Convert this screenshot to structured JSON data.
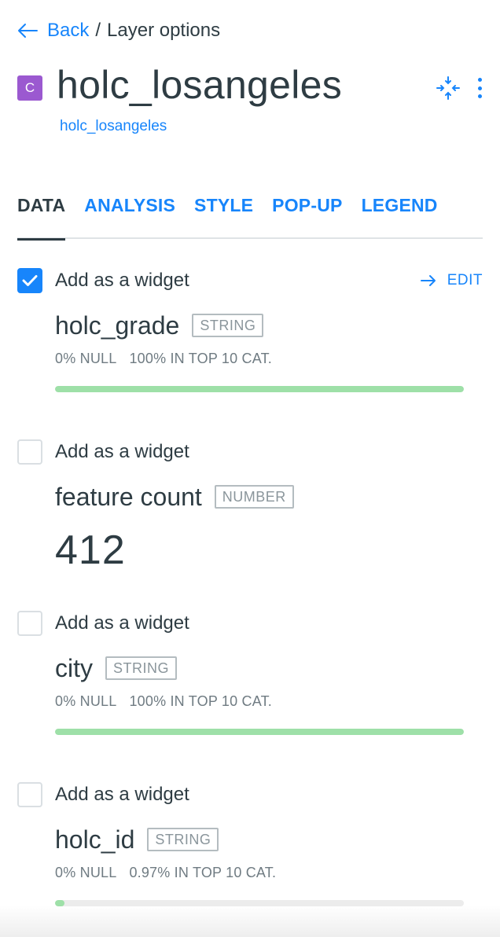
{
  "breadcrumb": {
    "back_label": "Back",
    "separator": "/",
    "current": "Layer options"
  },
  "layer": {
    "badge_letter": "C",
    "badge_color": "#9b59d0",
    "title": "holc_losangeles",
    "source_link": "holc_losangeles"
  },
  "header_icons": [
    "collapse-icon",
    "more-options-icon"
  ],
  "tabs": [
    {
      "label": "DATA",
      "active": true
    },
    {
      "label": "ANALYSIS",
      "active": false
    },
    {
      "label": "STYLE",
      "active": false
    },
    {
      "label": "POP-UP",
      "active": false
    },
    {
      "label": "LEGEND",
      "active": false
    }
  ],
  "widgets": [
    {
      "add_label": "Add as a widget",
      "checked": true,
      "edit_label": "EDIT",
      "field": "holc_grade",
      "type": "STRING",
      "null_stat": "0% NULL",
      "top_stat": "100% IN TOP 10 CAT.",
      "progress_fraction": 1.0
    },
    {
      "add_label": "Add as a widget",
      "checked": false,
      "field": "feature count",
      "type": "NUMBER",
      "value": "412"
    },
    {
      "add_label": "Add as a widget",
      "checked": false,
      "field": "city",
      "type": "STRING",
      "null_stat": "0% NULL",
      "top_stat": "100% IN TOP 10 CAT.",
      "progress_fraction": 1.0
    },
    {
      "add_label": "Add as a widget",
      "checked": false,
      "field": "holc_id",
      "type": "STRING",
      "null_stat": "0% NULL",
      "top_stat": "0.97% IN TOP 10 CAT.",
      "progress_fraction": 0.0097
    }
  ],
  "colors": {
    "accent": "#1785fb",
    "text": "#2e3c43",
    "muted": "#6f7b82",
    "progress_fill": "#9ee0a8"
  }
}
